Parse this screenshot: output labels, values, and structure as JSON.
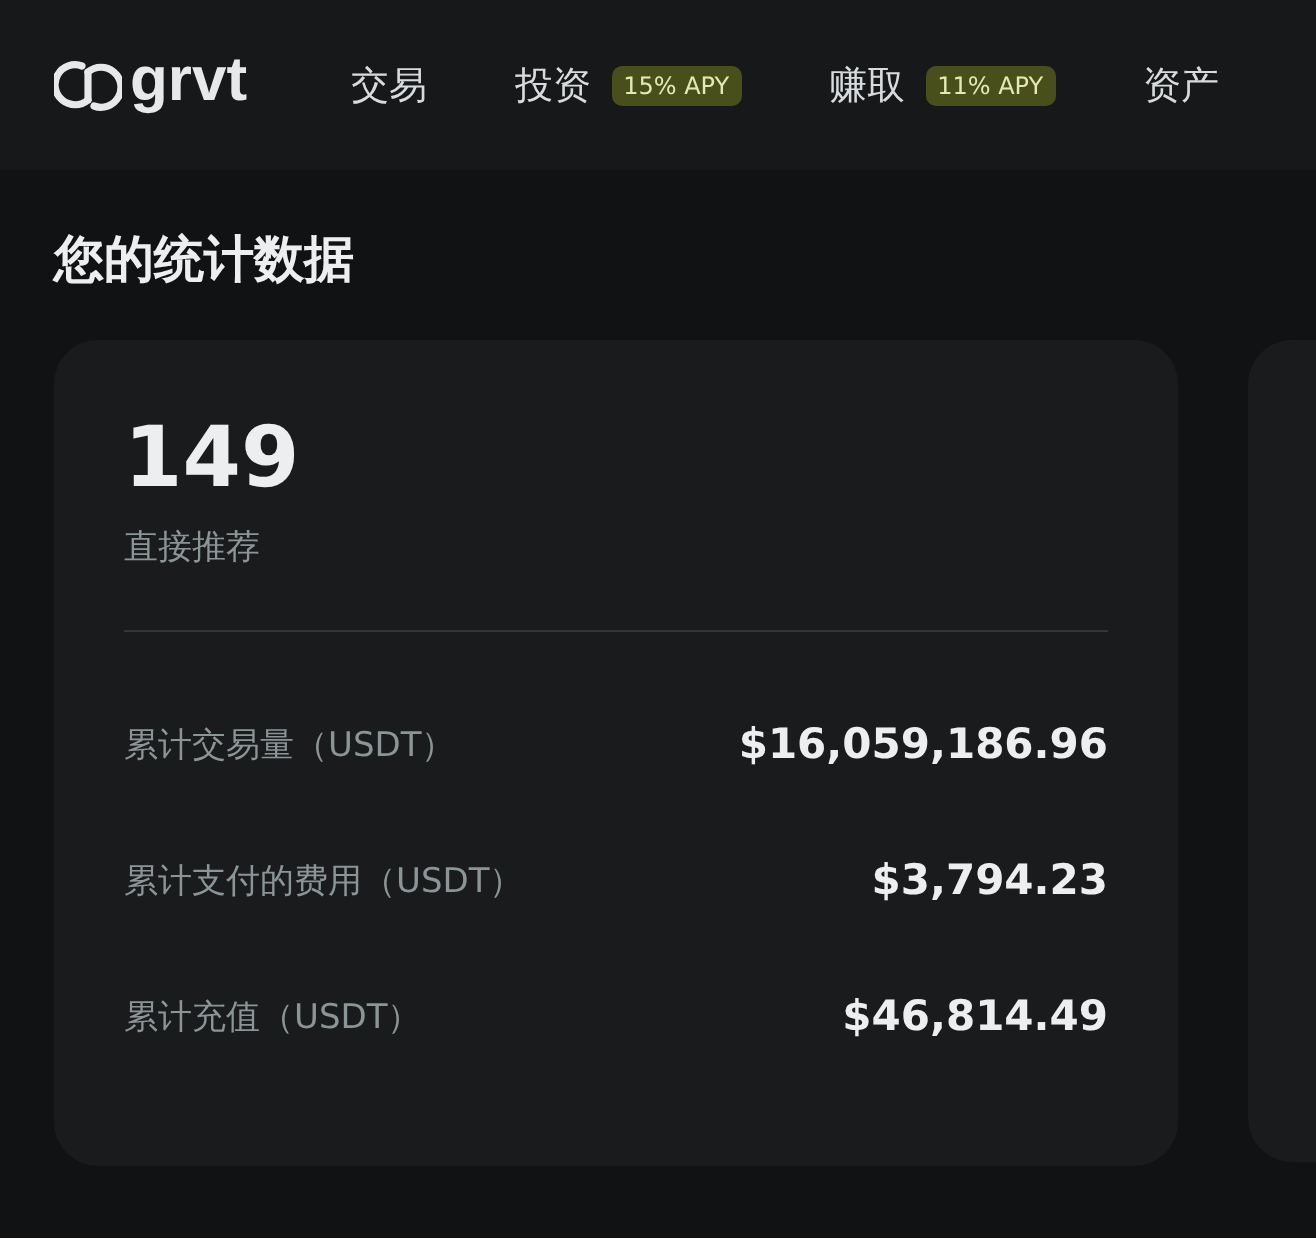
{
  "header": {
    "logo": "grvt",
    "nav": [
      {
        "label": "交易"
      },
      {
        "label": "投资",
        "badge": "15% APY"
      },
      {
        "label": "赚取",
        "badge": "11% APY"
      },
      {
        "label": "资产"
      }
    ]
  },
  "section_title": "您的统计数据",
  "stats_card": {
    "value": "149",
    "caption": "直接推荐",
    "rows": [
      {
        "label": "累计交易量（USDT）",
        "value": "$16,059,186.96"
      },
      {
        "label": "累计支付的费用（USDT）",
        "value": "$3,794.23"
      },
      {
        "label": "累计充值（USDT）",
        "value": "$46,814.49"
      }
    ]
  }
}
